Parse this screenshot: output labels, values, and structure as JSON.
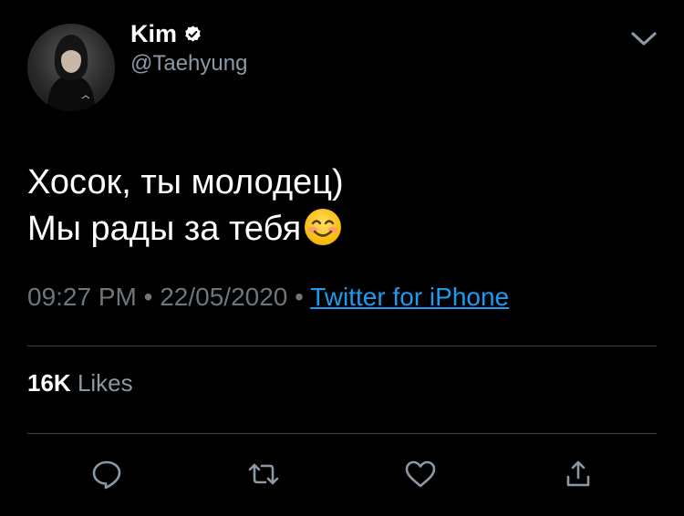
{
  "author": {
    "name": "Kim",
    "handle": "@Taehyung",
    "verified": true,
    "avatar_icon": "hooded-person-avatar"
  },
  "tweet": {
    "lines": [
      "Хосок, ты молодец)",
      "Мы рады за тебя"
    ],
    "emoji": "smiling-face-emoji"
  },
  "meta": {
    "time": "09:27 PM",
    "separator": " • ",
    "date": "22/05/2020",
    "source": "Twitter for iPhone"
  },
  "stats": {
    "likes_count": "16K",
    "likes_label": "Likes"
  },
  "actions": [
    "reply-icon",
    "retweet-icon",
    "like-icon",
    "share-icon"
  ],
  "colors": {
    "background": "#000000",
    "text": "#ffffff",
    "secondary": "#8b98a5",
    "link": "#1d9bf0",
    "divider": "#38444d",
    "action_icon": "#8b98a5"
  }
}
